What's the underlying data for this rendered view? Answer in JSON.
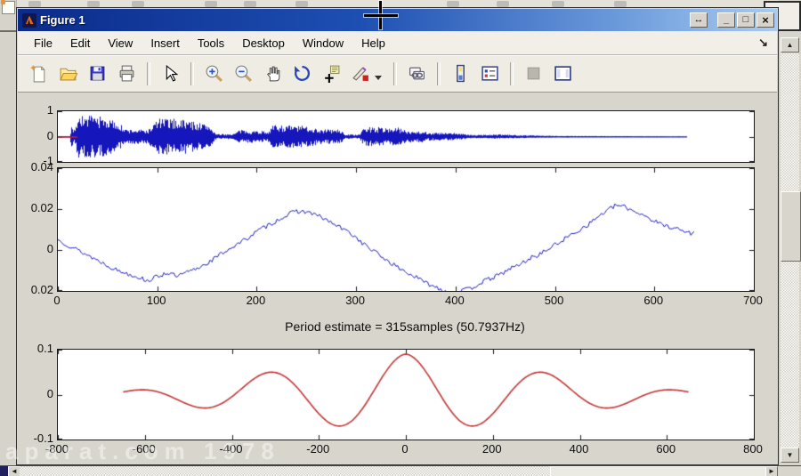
{
  "window": {
    "title": "Figure 1",
    "controls": {
      "dock": "↔",
      "minimize": "_",
      "maximize": "□",
      "close": "×"
    },
    "dock_figure_arrow": "↘"
  },
  "menu": {
    "items": [
      "File",
      "Edit",
      "View",
      "Insert",
      "Tools",
      "Desktop",
      "Window",
      "Help"
    ]
  },
  "toolbar": {
    "icons": [
      "new-file",
      "open-file",
      "save-figure",
      "print-figure",
      "edit-plot",
      "zoom-in",
      "zoom-out",
      "pan",
      "rotate-3d",
      "data-cursor",
      "brush-data",
      "link-plot",
      "insert-colorbar",
      "insert-legend",
      "hide-plot-tools",
      "show-plot-tools"
    ]
  },
  "scrollbars": {
    "up": "▲",
    "down": "▼",
    "left": "◄",
    "right": "►"
  },
  "watermark": "aparat.com 1978",
  "chart_data": [
    {
      "type": "line",
      "description": "speech signal waveform",
      "color": "#1616bd",
      "lead_line_color": "#cc2222",
      "lead_line_end_fraction": 0.028,
      "end_fraction": 0.904,
      "ylim": [
        -1,
        1
      ],
      "yticks": [
        1,
        0,
        -1
      ],
      "yticklabels": [
        "1",
        "0",
        "-1"
      ],
      "envelope": [
        [
          0,
          0.02
        ],
        [
          0.017,
          0.02
        ],
        [
          0.019,
          0.55
        ],
        [
          0.022,
          0.2
        ],
        [
          0.028,
          0.92
        ],
        [
          0.06,
          0.88
        ],
        [
          0.088,
          0.6
        ],
        [
          0.095,
          0.32
        ],
        [
          0.13,
          0.3
        ],
        [
          0.143,
          0.78
        ],
        [
          0.18,
          0.75
        ],
        [
          0.218,
          0.5
        ],
        [
          0.227,
          0.1
        ],
        [
          0.252,
          0.12
        ],
        [
          0.26,
          0.28
        ],
        [
          0.3,
          0.24
        ],
        [
          0.31,
          0.5
        ],
        [
          0.36,
          0.45
        ],
        [
          0.375,
          0.33
        ],
        [
          0.405,
          0.3
        ],
        [
          0.413,
          0.09
        ],
        [
          0.433,
          0.09
        ],
        [
          0.44,
          0.42
        ],
        [
          0.49,
          0.38
        ],
        [
          0.5,
          0.26
        ],
        [
          0.525,
          0.24
        ],
        [
          0.533,
          0.17
        ],
        [
          0.58,
          0.15
        ],
        [
          0.59,
          0.07
        ],
        [
          0.63,
          0.09
        ],
        [
          0.665,
          0.07
        ],
        [
          0.7,
          0.035
        ],
        [
          0.75,
          0.028
        ],
        [
          0.82,
          0.02
        ],
        [
          0.904,
          0.015
        ]
      ]
    },
    {
      "type": "line",
      "description": "noisy pitch contour",
      "color": "#1616bd",
      "xlim": [
        0,
        700
      ],
      "ylim": [
        -0.02,
        0.04
      ],
      "xticks": [
        0,
        100,
        200,
        300,
        400,
        500,
        600,
        700
      ],
      "xticklabels": [
        "0",
        "100",
        "200",
        "300",
        "400",
        "500",
        "600",
        "700"
      ],
      "yticks": [
        0.04,
        0.02,
        0,
        -0.02
      ],
      "yticklabels": [
        "0.04",
        "0.02",
        "0",
        "0.02"
      ],
      "noise": 0.0011,
      "points": [
        [
          0,
          0.005
        ],
        [
          20,
          0.0
        ],
        [
          40,
          -0.005
        ],
        [
          60,
          -0.01
        ],
        [
          80,
          -0.013
        ],
        [
          90,
          -0.015
        ],
        [
          100,
          -0.013
        ],
        [
          110,
          -0.011
        ],
        [
          120,
          -0.013
        ],
        [
          130,
          -0.011
        ],
        [
          140,
          -0.009
        ],
        [
          155,
          -0.005
        ],
        [
          170,
          0.0
        ],
        [
          185,
          0.004
        ],
        [
          200,
          0.009
        ],
        [
          215,
          0.013
        ],
        [
          230,
          0.017
        ],
        [
          240,
          0.019
        ],
        [
          252,
          0.0185
        ],
        [
          265,
          0.016
        ],
        [
          280,
          0.012
        ],
        [
          295,
          0.008
        ],
        [
          310,
          0.002
        ],
        [
          325,
          -0.003
        ],
        [
          340,
          -0.008
        ],
        [
          355,
          -0.012
        ],
        [
          370,
          -0.016
        ],
        [
          385,
          -0.019
        ],
        [
          395,
          -0.021
        ],
        [
          405,
          -0.02
        ],
        [
          415,
          -0.019
        ],
        [
          425,
          -0.016
        ],
        [
          435,
          -0.014
        ],
        [
          445,
          -0.012
        ],
        [
          455,
          -0.009
        ],
        [
          465,
          -0.007
        ],
        [
          475,
          -0.004
        ],
        [
          485,
          -0.002
        ],
        [
          495,
          0.001
        ],
        [
          505,
          0.004
        ],
        [
          515,
          0.007
        ],
        [
          525,
          0.01
        ],
        [
          535,
          0.013
        ],
        [
          545,
          0.017
        ],
        [
          555,
          0.02
        ],
        [
          562,
          0.022
        ],
        [
          570,
          0.021
        ],
        [
          580,
          0.019
        ],
        [
          590,
          0.017
        ],
        [
          600,
          0.014
        ],
        [
          610,
          0.012
        ],
        [
          620,
          0.011
        ],
        [
          630,
          0.009
        ],
        [
          640,
          0.008
        ]
      ]
    },
    {
      "type": "line",
      "description": "autocorrelation",
      "title": "Period estimate = 315samples (50.7937Hz)",
      "color": "#c23434",
      "xlim": [
        -800,
        800
      ],
      "ylim": [
        -0.1,
        0.1
      ],
      "xticks": [
        -800,
        -600,
        -400,
        -200,
        0,
        200,
        400,
        600,
        800
      ],
      "xticklabels": [
        "-800",
        "-600",
        "-400",
        "-200",
        "0",
        "200",
        "400",
        "600",
        "800"
      ],
      "yticks": [
        0.1,
        0,
        -0.1
      ],
      "yticklabels": [
        "0.1",
        "0",
        "-0.1"
      ],
      "points": [
        [
          -650,
          0.0059
        ],
        [
          -625,
          0.0096
        ],
        [
          -600,
          0.0106
        ],
        [
          -575,
          0.0073
        ],
        [
          -550,
          -0.0005
        ],
        [
          -525,
          -0.0113
        ],
        [
          -500,
          -0.022
        ],
        [
          -475,
          -0.0289
        ],
        [
          -450,
          -0.029
        ],
        [
          -425,
          -0.0206
        ],
        [
          -400,
          -0.0048
        ],
        [
          -375,
          0.0152
        ],
        [
          -350,
          0.0345
        ],
        [
          -325,
          0.0473
        ],
        [
          -300,
          0.0491
        ],
        [
          -275,
          0.0381
        ],
        [
          -250,
          0.0157
        ],
        [
          -225,
          -0.0136
        ],
        [
          -200,
          -0.0425
        ],
        [
          -175,
          -0.0634
        ],
        [
          -150,
          -0.0699
        ],
        [
          -125,
          -0.059
        ],
        [
          -100,
          -0.0317
        ],
        [
          -75,
          0.006
        ],
        [
          -50,
          0.0453
        ],
        [
          -25,
          0.0762
        ],
        [
          0,
          0.09
        ],
        [
          25,
          0.0762
        ],
        [
          50,
          0.0453
        ],
        [
          75,
          0.006
        ],
        [
          100,
          -0.0317
        ],
        [
          125,
          -0.059
        ],
        [
          150,
          -0.0699
        ],
        [
          175,
          -0.0634
        ],
        [
          200,
          -0.0425
        ],
        [
          225,
          -0.0136
        ],
        [
          250,
          0.0157
        ],
        [
          275,
          0.0381
        ],
        [
          300,
          0.0491
        ],
        [
          325,
          0.0473
        ],
        [
          350,
          0.0345
        ],
        [
          375,
          0.0152
        ],
        [
          400,
          -0.0048
        ],
        [
          425,
          -0.0206
        ],
        [
          450,
          -0.029
        ],
        [
          475,
          -0.0289
        ],
        [
          500,
          -0.022
        ],
        [
          525,
          -0.0113
        ],
        [
          550,
          -0.0005
        ],
        [
          575,
          0.0073
        ],
        [
          600,
          0.0106
        ],
        [
          625,
          0.0096
        ],
        [
          650,
          0.0059
        ]
      ]
    }
  ]
}
